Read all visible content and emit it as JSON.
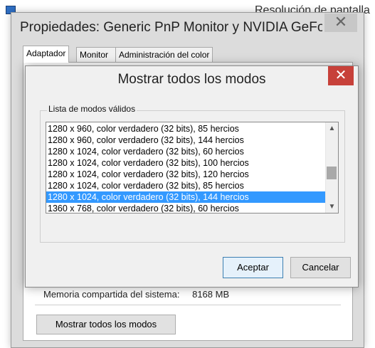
{
  "background_window": {
    "title": "Resolución de pantalla"
  },
  "properties_window": {
    "title": "Propiedades: Generic PnP Monitor y NVIDIA GeForce",
    "close_glyph": "✕",
    "tabs": [
      {
        "label": "Adaptador"
      },
      {
        "label": "Monitor"
      },
      {
        "label": "Administración del color"
      }
    ],
    "memory_label": "Memoria compartida del sistema:",
    "memory_value": "8168 MB",
    "list_all_modes_button": "Mostrar todos los modos"
  },
  "dialog": {
    "title": "Mostrar todos los modos",
    "close_glyph": "✕",
    "group_label": "Lista de modos válidos",
    "modes": [
      {
        "text": "1280 x 960, color verdadero (32 bits), 85 hercios",
        "selected": false
      },
      {
        "text": "1280 x 960, color verdadero (32 bits), 144 hercios",
        "selected": false
      },
      {
        "text": "1280 x 1024, color verdadero (32 bits), 60 hercios",
        "selected": false
      },
      {
        "text": "1280 x 1024, color verdadero (32 bits), 100 hercios",
        "selected": false
      },
      {
        "text": "1280 x 1024, color verdadero (32 bits), 120 hercios",
        "selected": false
      },
      {
        "text": "1280 x 1024, color verdadero (32 bits), 85 hercios",
        "selected": false
      },
      {
        "text": "1280 x 1024, color verdadero (32 bits), 144 hercios",
        "selected": true
      },
      {
        "text": "1360 x 768, color verdadero (32 bits), 60 hercios",
        "selected": false
      }
    ],
    "ok_button": "Aceptar",
    "cancel_button": "Cancelar"
  },
  "colors": {
    "selection": "#3399ff",
    "close_red": "#c7413a"
  }
}
